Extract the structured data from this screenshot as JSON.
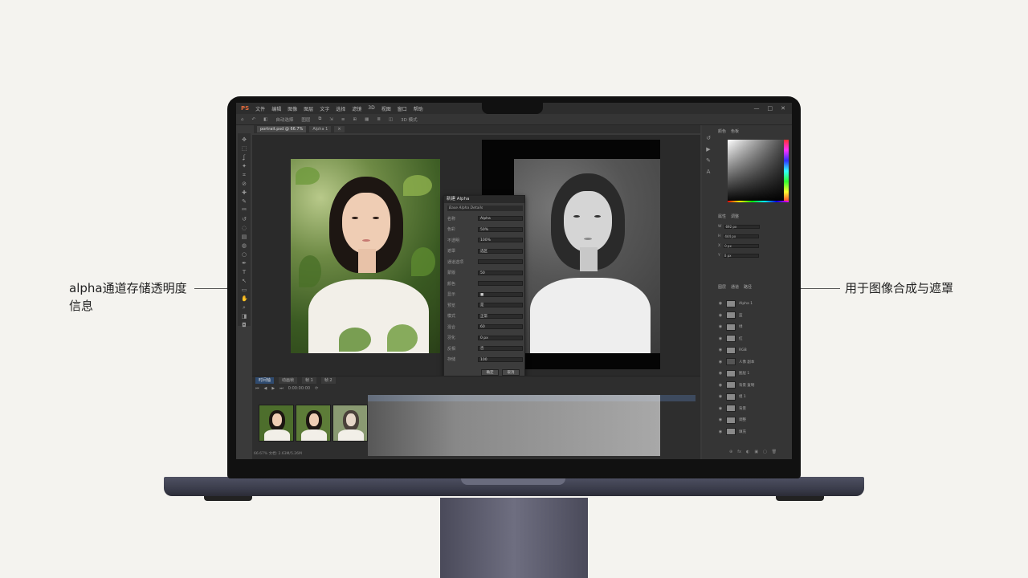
{
  "annotations": {
    "left": "alpha通道存储透明度信息",
    "right": "用于图像合成与遮罩"
  },
  "app": {
    "logo": "PS",
    "menu": [
      "文件",
      "编辑",
      "图像",
      "图层",
      "文字",
      "选择",
      "滤镜",
      "3D",
      "视图",
      "窗口",
      "帮助"
    ],
    "window_controls": [
      "—",
      "□",
      "✕"
    ]
  },
  "options_bar": [
    "⌂",
    "↶",
    "◧",
    "自动选择",
    "图层",
    "⧉",
    "⇲",
    "≡",
    "⊞",
    "▦",
    "≣",
    "◫",
    "3D 模式"
  ],
  "doc_tabs": [
    {
      "label": "portrait.psd @ 66.7%",
      "active": true
    },
    {
      "label": "Alpha 1",
      "active": false
    },
    {
      "label": "×",
      "active": false
    }
  ],
  "tools": [
    "move-icon",
    "marquee-icon",
    "lasso-icon",
    "wand-icon",
    "crop-icon",
    "eyedropper-icon",
    "heal-icon",
    "brush-icon",
    "stamp-icon",
    "history-icon",
    "eraser-icon",
    "gradient-icon",
    "blur-icon",
    "dodge-icon",
    "pen-icon",
    "type-icon",
    "path-icon",
    "shape-icon",
    "hand-icon",
    "zoom-icon",
    "fg-bg-icon",
    "mask-icon"
  ],
  "tool_glyphs": [
    "✥",
    "⬚",
    "ʆ",
    "✦",
    "⌗",
    "⊘",
    "✚",
    "✎",
    "⎃",
    "↺",
    "◌",
    "▤",
    "◍",
    "○",
    "✒",
    "T",
    "↖",
    "▭",
    "✋",
    "⌕",
    "◨",
    "◘"
  ],
  "dialog": {
    "title": "新建 Alpha",
    "subtitle": "Base Alpha Details",
    "fields": [
      {
        "label": "名称",
        "value": "Alpha"
      },
      {
        "label": "色彩",
        "value": "50%"
      },
      {
        "label": "不透明",
        "value": "100%"
      },
      {
        "label": "遮罩",
        "value": "选区"
      },
      {
        "label": "通道选项",
        "value": ""
      },
      {
        "label": "蒙版",
        "value": "50"
      },
      {
        "label": "颜色",
        "value": ""
      },
      {
        "label": "显示",
        "value": "■"
      },
      {
        "label": "预览",
        "value": "是"
      },
      {
        "label": "模式",
        "value": "正常"
      },
      {
        "label": "混合",
        "value": "60"
      },
      {
        "label": "羽化",
        "value": "0 px"
      },
      {
        "label": "反相",
        "value": "否"
      },
      {
        "label": "存储",
        "value": "100"
      }
    ],
    "ok": "确定",
    "cancel": "取消"
  },
  "right_panel": {
    "top_tabs": [
      "颜色",
      "色板"
    ],
    "props_tabs": [
      "属性",
      "调整"
    ],
    "props_rows": [
      {
        "label": "W",
        "value": "692 px"
      },
      {
        "label": "H",
        "value": "444 px"
      },
      {
        "label": "X",
        "value": "0 px"
      },
      {
        "label": "Y",
        "value": "0 px"
      }
    ],
    "layers_tabs": [
      "图层",
      "通道",
      "路径"
    ],
    "layers": [
      {
        "name": "Alpha 1",
        "dark": false
      },
      {
        "name": "蓝",
        "dark": false
      },
      {
        "name": "绿",
        "dark": false
      },
      {
        "name": "红",
        "dark": false
      },
      {
        "name": "RGB",
        "dark": false
      },
      {
        "name": "人像 副本",
        "dark": true
      },
      {
        "name": "图层 1",
        "dark": false
      },
      {
        "name": "背景 复制",
        "dark": false
      },
      {
        "name": "组 1",
        "dark": false
      },
      {
        "name": "背景",
        "dark": false
      },
      {
        "name": "调整",
        "dark": false
      },
      {
        "name": "填充",
        "dark": false
      }
    ],
    "footer_icons": [
      "⊕",
      "fx",
      "◐",
      "▣",
      "▢",
      "🗑"
    ]
  },
  "timeline": {
    "tabs": [
      {
        "label": "时间轴",
        "active": true
      },
      {
        "label": "动画帧",
        "active": false
      },
      {
        "label": "帧 1",
        "active": false
      },
      {
        "label": "帧 2",
        "active": false
      }
    ],
    "controls": [
      "⏮",
      "◀",
      "▶",
      "⏭",
      "0:00:00:00",
      "⟳"
    ],
    "status": "66.67%   文档: 2.63M/5.26M"
  },
  "colors": {
    "accent": "#2f4b70",
    "ps_logo": "#e36a3b"
  }
}
